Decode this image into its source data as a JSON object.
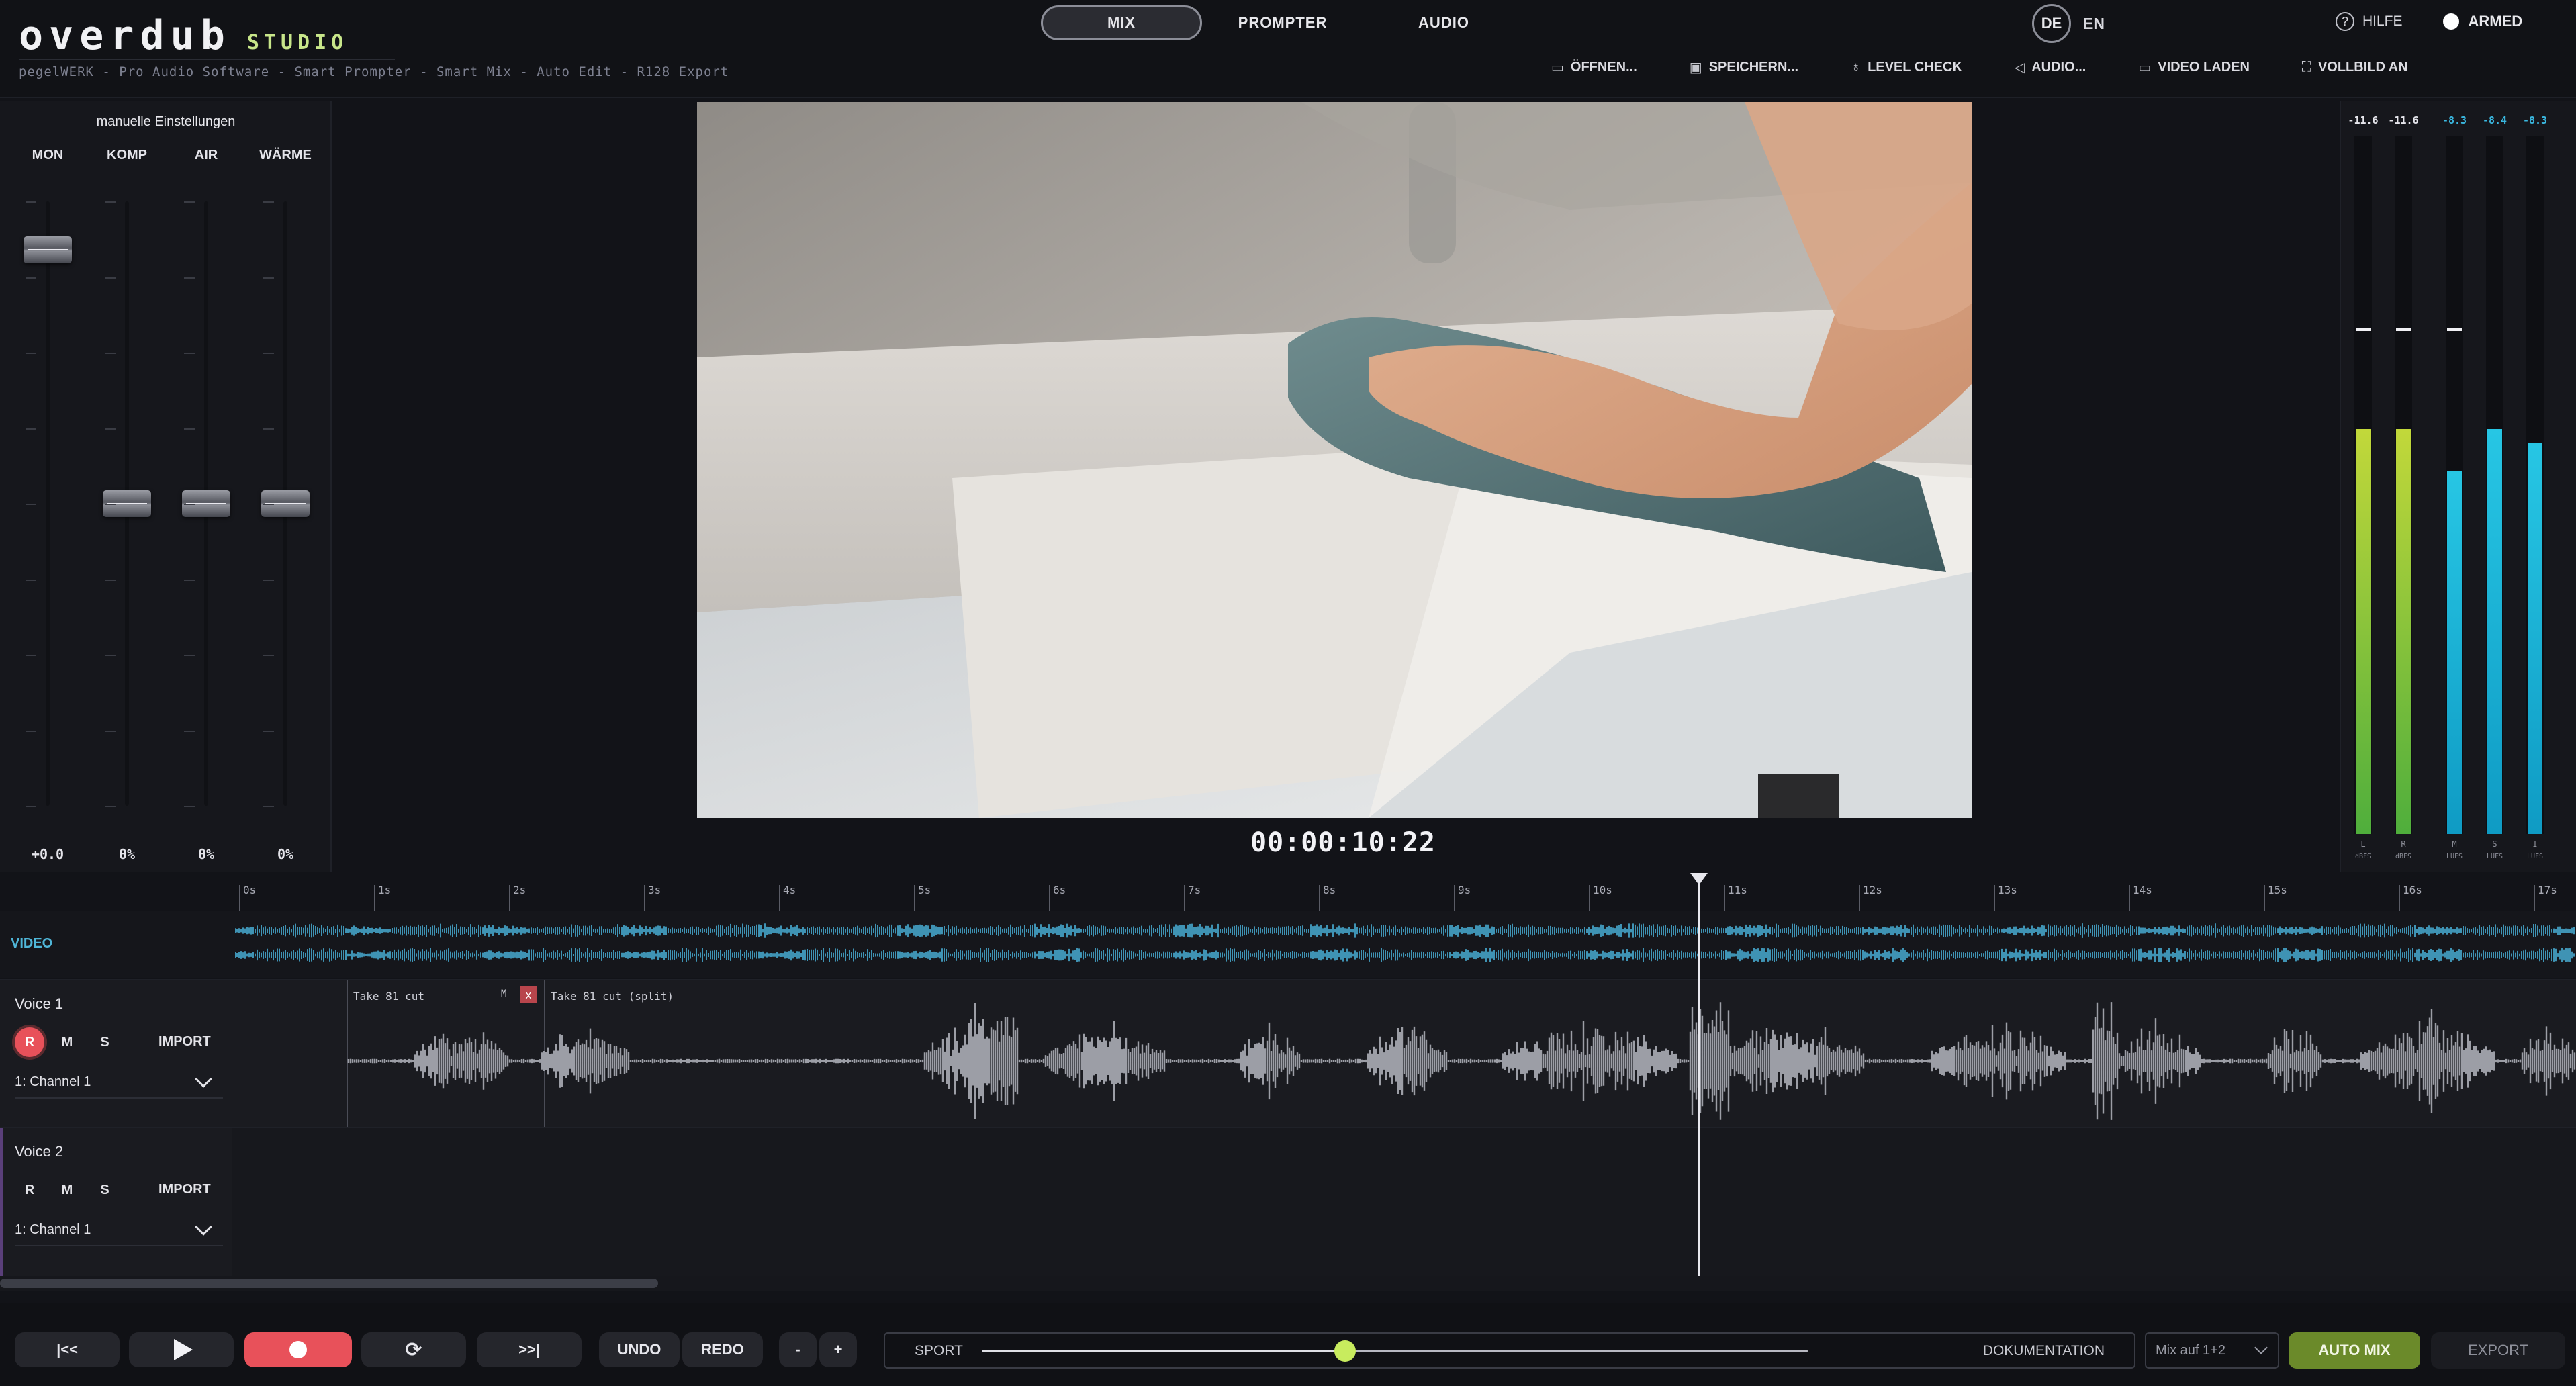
{
  "app": {
    "logo": "overdub",
    "logo_suffix": "STUDIO",
    "tagline": "pegelWERK - Pro Audio Software  -  Smart Prompter  -  Smart Mix  -  Auto Edit  -  R128 Export"
  },
  "modes": [
    {
      "label": "MIX",
      "active": true
    },
    {
      "label": "PROMPTER",
      "active": false
    },
    {
      "label": "AUDIO",
      "active": false
    }
  ],
  "language": {
    "active": "DE",
    "other": "EN"
  },
  "help_label": "HILFE",
  "armed_label": "ARMED",
  "actions": [
    {
      "icon": "folder-icon",
      "label": "ÖFFNEN..."
    },
    {
      "icon": "save-icon",
      "label": "SPEICHERN..."
    },
    {
      "icon": "microphone-icon",
      "label": "LEVEL CHECK"
    },
    {
      "icon": "speaker-icon",
      "label": "AUDIO..."
    },
    {
      "icon": "camera-icon",
      "label": "VIDEO LADEN"
    },
    {
      "icon": "fullscreen-icon",
      "label": "VOLLBILD AN"
    }
  ],
  "strip": {
    "title": "manuelle Einstellungen",
    "channels": [
      {
        "label": "MON",
        "value": "+0.0",
        "level": 0.92
      },
      {
        "label": "KOMP",
        "value": "0%",
        "level": 0.0
      },
      {
        "label": "AIR",
        "value": "0%",
        "level": 0.0
      },
      {
        "label": "WÄRME",
        "value": "0%",
        "level": 0.0
      }
    ]
  },
  "timecode": "00:00:10:22",
  "meters": [
    {
      "header": "-11.6",
      "label": "L",
      "unit": "dBFS",
      "level": 0.58,
      "peak": 0.72,
      "color": "#b7d43a",
      "header_color": "#e6e6ec"
    },
    {
      "header": "-11.6",
      "label": "R",
      "unit": "dBFS",
      "level": 0.58,
      "peak": 0.72,
      "color": "#b7d43a",
      "header_color": "#e6e6ec"
    },
    {
      "header": "-8.3",
      "label": "M",
      "unit": "LUFS",
      "level": 0.52,
      "peak": 0.72,
      "color": "#1fb7d6",
      "header_color": "#3ab8e0"
    },
    {
      "header": "-8.4",
      "label": "S",
      "unit": "LUFS",
      "level": 0.58,
      "peak": 0.0,
      "color": "#1fb7d6",
      "header_color": "#3ab8e0"
    },
    {
      "header": "-8.3",
      "label": "I",
      "unit": "LUFS",
      "level": 0.56,
      "peak": 0.0,
      "color": "#1fb7d6",
      "header_color": "#3ab8e0"
    }
  ],
  "ruler": [
    "0s",
    "1s",
    "2s",
    "3s",
    "4s",
    "5s",
    "6s",
    "7s",
    "8s",
    "9s",
    "10s",
    "11s",
    "12s",
    "13s",
    "14s",
    "15s",
    "16s",
    "17s"
  ],
  "video_track": {
    "label": "VIDEO"
  },
  "voices": [
    {
      "name": "Voice 1",
      "rec": "R",
      "mute": "M",
      "solo": "S",
      "import": "IMPORT",
      "channel": "1: Channel 1",
      "armed": true,
      "clips": [
        {
          "label": "Take 81 cut",
          "mute": "M",
          "close": "x"
        },
        {
          "label": "Take 81 cut (split)"
        }
      ]
    },
    {
      "name": "Voice 2",
      "rec": "R",
      "mute": "M",
      "solo": "S",
      "import": "IMPORT",
      "channel": "1: Channel 1",
      "armed": false,
      "clips": []
    }
  ],
  "transport": {
    "to_start": "|<<",
    "to_end": ">>|",
    "undo": "UNDO",
    "redo": "REDO",
    "zoom_out": "-",
    "zoom_in": "+",
    "mix_left": "SPORT",
    "mix_right": "DOKUMENTATION",
    "mix_value": 0.44,
    "select_value": "Mix auf 1+2",
    "automix": "AUTO MIX",
    "export": "EXPORT"
  }
}
